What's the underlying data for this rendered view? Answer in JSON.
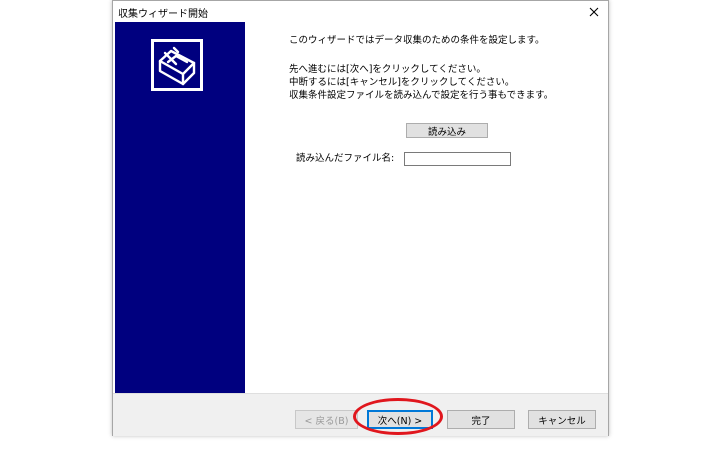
{
  "window": {
    "title": "収集ウィザード開始"
  },
  "content": {
    "intro": "このウィザードではデータ収集のための条件を設定します。",
    "instructions": [
      "先へ進むには[次へ]をクリックしてください。",
      "中断するには[キャンセル]をクリックしてください。",
      "収集条件設定ファイルを読み込んで設定を行う事もできます。"
    ],
    "load_button": "読み込み",
    "file_label": "読み込んだファイル名:",
    "file_value": ""
  },
  "footer": {
    "back_label": "< 戻る(B)",
    "next_label": "次へ(N) >",
    "finish_label": "完了",
    "cancel_label": "キャンセル"
  },
  "colors": {
    "side_panel": "#00007f",
    "highlight": "#e0161d"
  }
}
